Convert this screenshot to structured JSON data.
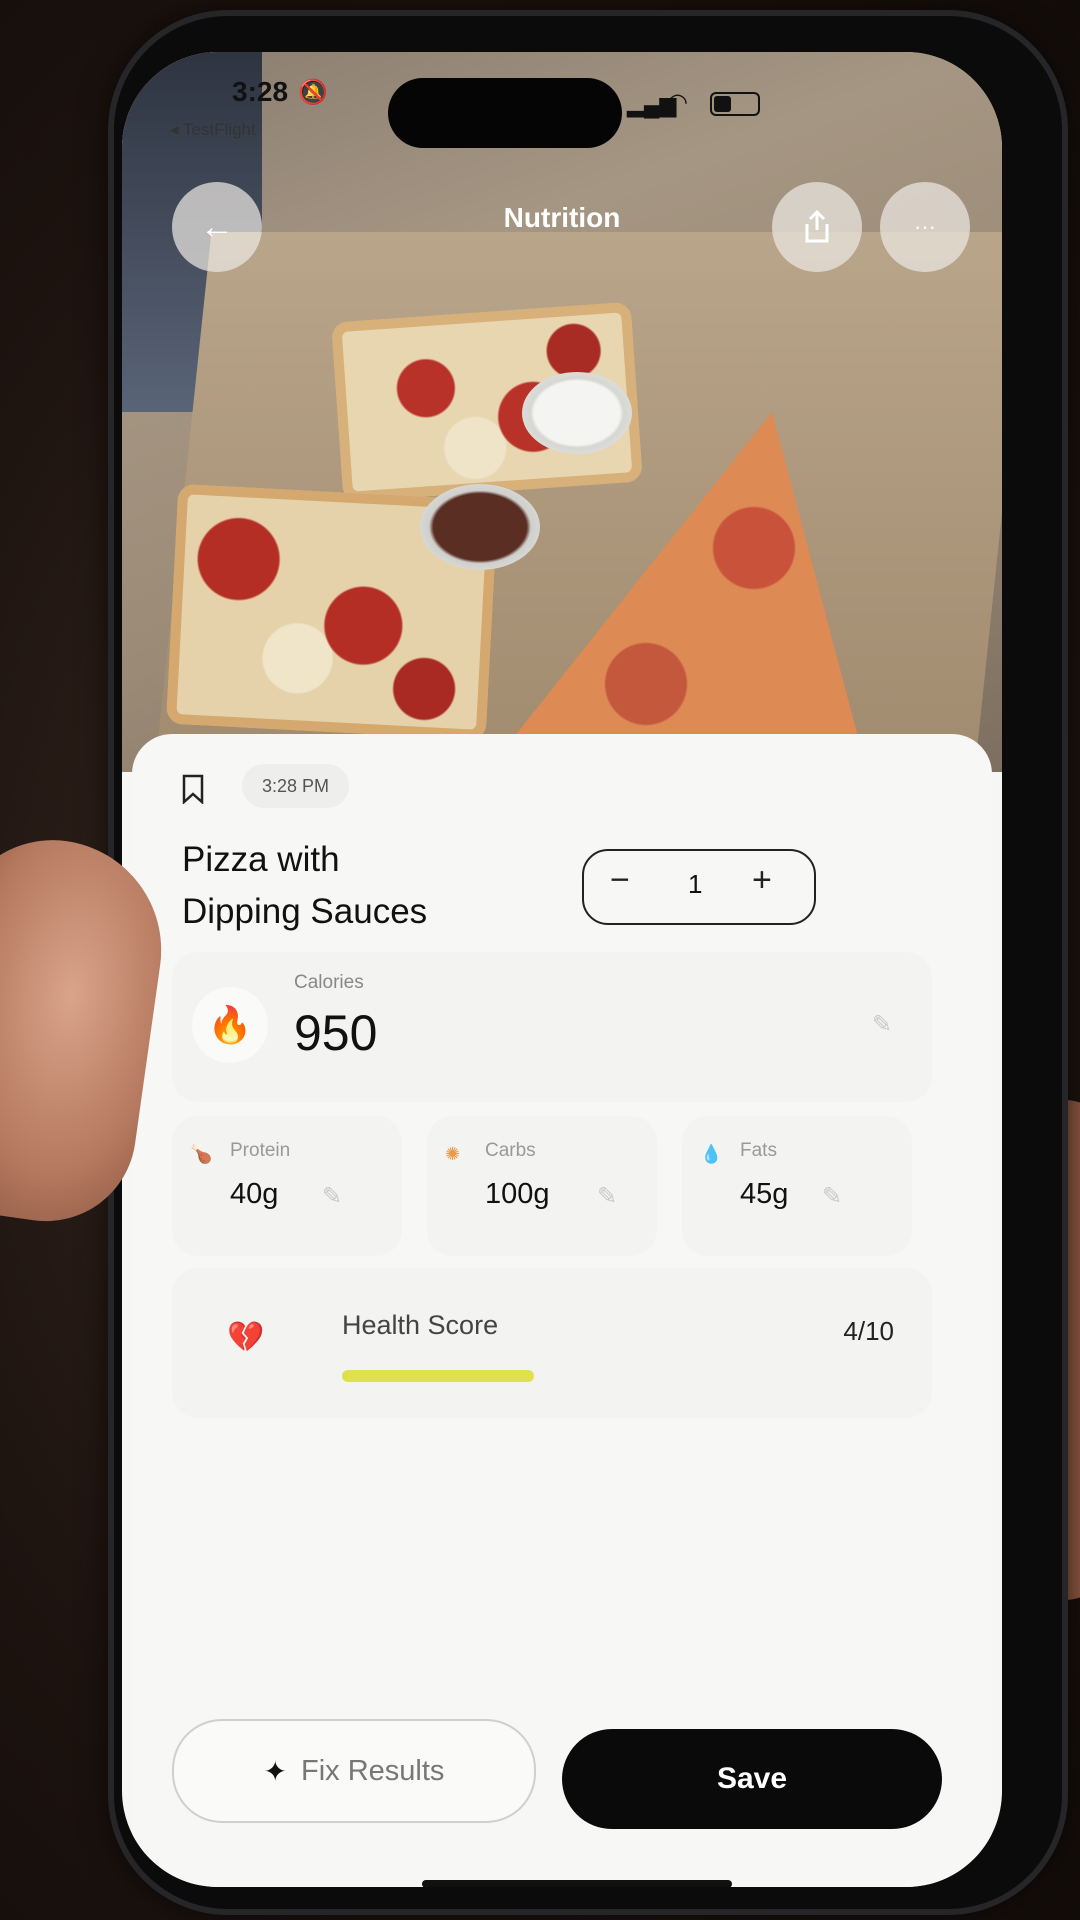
{
  "status_bar": {
    "time": "3:28",
    "back_app": "◂ TestFlight",
    "battery_level": 0.4
  },
  "header": {
    "title": "Nutrition",
    "back_icon": "arrow-left-icon",
    "share_icon": "share-icon",
    "more_icon": "more-horizontal-icon"
  },
  "sheet": {
    "time": "3:28 PM",
    "dish_name_line1": "Pizza with",
    "dish_name_line2": "Dipping Sauces",
    "quantity": "1",
    "calories": {
      "label": "Calories",
      "value": "950"
    },
    "macros": [
      {
        "label": "Protein",
        "value": "40g",
        "icon": "drumstick-icon",
        "color": "#e0455a"
      },
      {
        "label": "Carbs",
        "value": "100g",
        "icon": "wheat-icon",
        "color": "#e89a4a"
      },
      {
        "label": "Fats",
        "value": "45g",
        "icon": "droplet-icon",
        "color": "#4a8fe0"
      }
    ],
    "health": {
      "label": "Health Score",
      "score": "4/10",
      "score_value": 4,
      "score_max": 10,
      "bar_color": "#dfe04e"
    },
    "buttons": {
      "fix": "Fix Results",
      "save": "Save"
    }
  }
}
